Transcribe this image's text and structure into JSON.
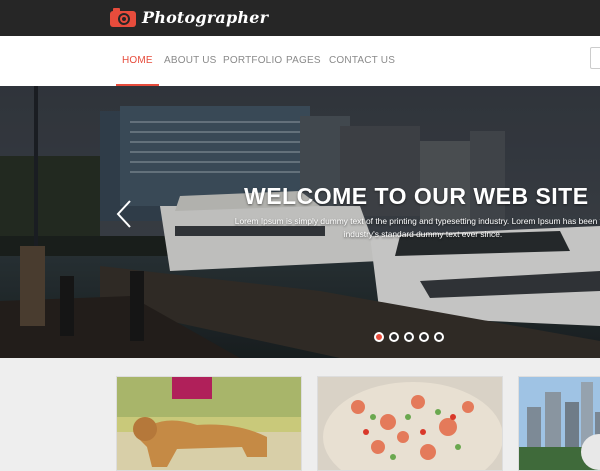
{
  "header": {
    "logo_text": "Photographer"
  },
  "nav": {
    "items": [
      {
        "label": "HOME",
        "active": true
      },
      {
        "label": "ABOUT US",
        "active": false
      },
      {
        "label": "PORTFOLIO",
        "active": false
      },
      {
        "label": "PAGES",
        "active": false
      },
      {
        "label": "CONTACT US",
        "active": false
      }
    ]
  },
  "hero": {
    "title": "WELCOME TO OUR WEB SITE",
    "text": "Lorem Ipsum is simply dummy text of the printing and typesetting industry. Lorem Ipsum has been the industry's standard dummy text ever since.",
    "prev_icon": "chevron-left-icon",
    "slides_total": 5,
    "active_slide": 1
  },
  "colors": {
    "accent": "#e74c3c",
    "topbar": "#262626",
    "nav_text": "#8a8a8a"
  }
}
